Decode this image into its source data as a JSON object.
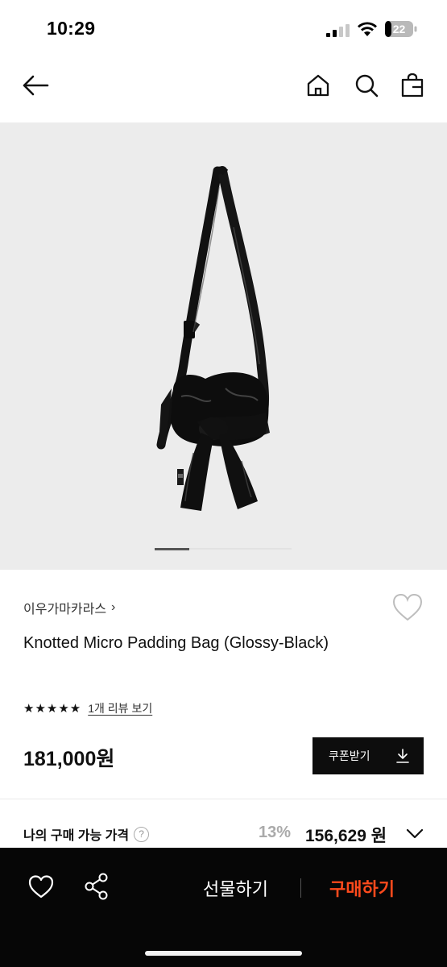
{
  "status_bar": {
    "time": "10:29",
    "battery": "22"
  },
  "nav": {
    "back_icon": "arrow-left-icon",
    "home_icon": "home-icon",
    "search_icon": "search-icon",
    "bag_icon": "shopping-bag-icon"
  },
  "gallery": {
    "current_slide": 1
  },
  "product": {
    "brand": "이우가마카라스",
    "brand_chevron": "›",
    "title": "Knotted Micro Padding Bag (Glossy-Black)",
    "stars": "★★★★★",
    "review_link": "1개 리뷰 보기",
    "price": "181,000원",
    "coupon_label": "쿠폰받기",
    "my_price_label": "나의 구매 가능 가격",
    "help": "?",
    "discount": "13%",
    "my_price": "156,629 원"
  },
  "bottom_bar": {
    "gift_label": "선물하기",
    "buy_label": "구매하기",
    "buy_color": "#ff4a1c"
  }
}
